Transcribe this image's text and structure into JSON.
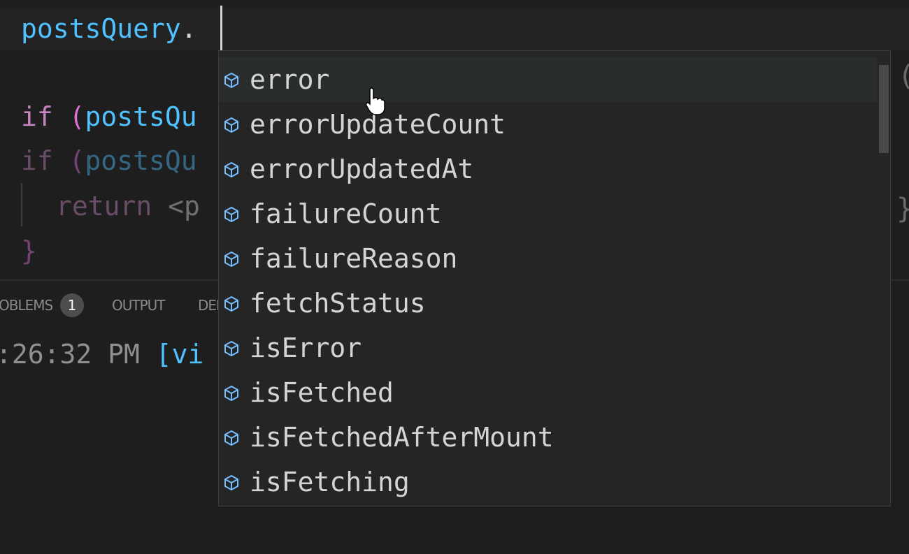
{
  "editor": {
    "lines": [
      {
        "var": "postsQuery",
        "dot": "."
      },
      {
        "kw": "if",
        "paren": " (",
        "var": "postsQu"
      },
      {
        "kw": "if",
        "paren": " (",
        "var": "postsQu"
      },
      {
        "kw": "return",
        "rest": " <p"
      },
      {
        "brace": "}"
      }
    ],
    "right_glyphs": [
      "(",
      "}"
    ]
  },
  "panel": {
    "tabs": {
      "problems": "OBLEMS",
      "problems_count": "1",
      "output": "OUTPUT",
      "debug": "DEI"
    },
    "terminal": {
      "time": ":26:32 PM ",
      "tag": "[vi"
    }
  },
  "suggest": {
    "selected_index": 0,
    "items": [
      {
        "label": "error",
        "icon": "property-box-icon"
      },
      {
        "label": "errorUpdateCount",
        "icon": "property-box-icon"
      },
      {
        "label": "errorUpdatedAt",
        "icon": "property-box-icon"
      },
      {
        "label": "failureCount",
        "icon": "property-box-icon"
      },
      {
        "label": "failureReason",
        "icon": "property-box-icon"
      },
      {
        "label": "fetchStatus",
        "icon": "property-box-icon"
      },
      {
        "label": "isError",
        "icon": "property-box-icon"
      },
      {
        "label": "isFetched",
        "icon": "property-box-icon"
      },
      {
        "label": "isFetchedAfterMount",
        "icon": "property-box-icon"
      },
      {
        "label": "isFetching",
        "icon": "property-box-icon"
      }
    ]
  },
  "colors": {
    "editor_bg": "#1e1e1e",
    "suggest_bg": "#252526",
    "variable": "#4fc1ff",
    "keyword": "#c586c0",
    "icon": "#75beff"
  }
}
